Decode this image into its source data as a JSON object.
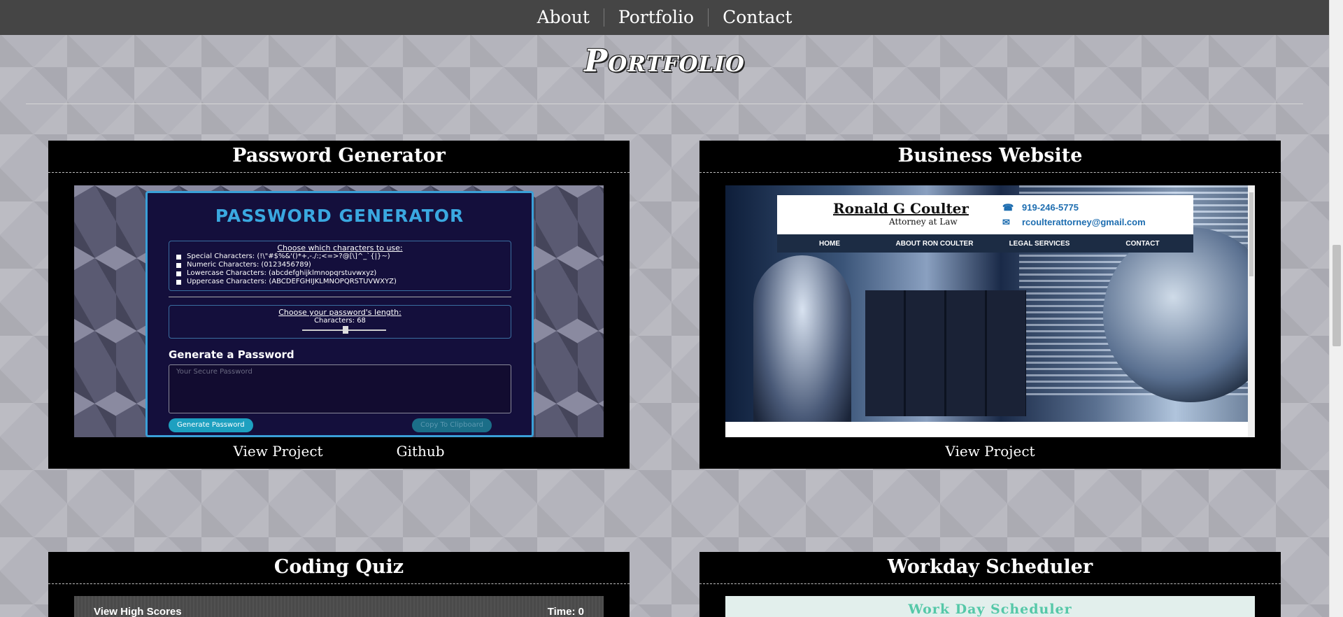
{
  "nav": {
    "items": [
      {
        "label": "About"
      },
      {
        "label": "Portfolio"
      },
      {
        "label": "Contact"
      }
    ]
  },
  "page": {
    "title": "Portfolio"
  },
  "cards": [
    {
      "title": "Password Generator",
      "links": [
        "View Project",
        "Github"
      ],
      "preview": {
        "heading": "PASSWORD GENERATOR",
        "choose_chars": "Choose which characters to use:",
        "options": [
          "Special Characters: (!\\\"#$%&'()*+,-./:;<=>?@[\\]^_`{|}~)",
          "Numeric Characters: (0123456789)",
          "Lowercase Characters: (abcdefghijklmnopqrstuvwxyz)",
          "Uppercase Characters: (ABCDEFGHIJKLMNOPQRSTUVWXYZ)"
        ],
        "choose_length": "Choose your password's length:",
        "characters": "Characters: 68",
        "generate_label": "Generate a Password",
        "textarea_placeholder": "Your Secure Password",
        "btn_generate": "Generate Password",
        "btn_copy": "Copy To Clipboard"
      }
    },
    {
      "title": "Business Website",
      "links": [
        "View Project"
      ],
      "preview": {
        "name": "Ronald G Coulter",
        "tagline": "Attorney at Law",
        "phone": "919-246-5775",
        "email": "rcoulterattorney@gmail.com",
        "menu": [
          "HOME",
          "ABOUT RON COULTER",
          "LEGAL SERVICES",
          "CONTACT"
        ]
      }
    },
    {
      "title": "Coding Quiz",
      "preview": {
        "high_scores": "View High Scores",
        "time": "Time: 0"
      }
    },
    {
      "title": "Workday Scheduler",
      "preview": {
        "heading": "Work Day Scheduler"
      }
    }
  ]
}
